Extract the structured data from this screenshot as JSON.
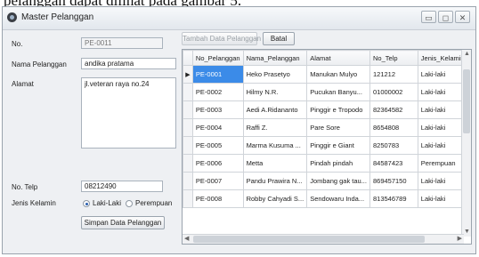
{
  "doc_text": "pelanggan dapat dilihat pada gambar 5.",
  "window": {
    "title": "Master Pelanggan",
    "min": "▭",
    "max": "◻",
    "close": "✕"
  },
  "form": {
    "no_label": "No.",
    "no_value": "PE-0011",
    "nama_label": "Nama Pelanggan",
    "nama_value": "andika pratama",
    "alamat_label": "Alamat",
    "alamat_value": "jl.veteran raya no.24",
    "telp_label": "No. Telp",
    "telp_value": "08212490",
    "jk_label": "Jenis Kelamin",
    "radio_laki": "Laki-Laki",
    "radio_perempuan": "Perempuan",
    "save_button": "Simpan Data Pelanggan",
    "add_button": "Tambah Data Pelanggan",
    "cancel_button": "Batal"
  },
  "grid": {
    "columns": [
      "No_Pelanggan",
      "Nama_Pelanggan",
      "Alamat",
      "No_Telp",
      "Jenis_Kelamin"
    ],
    "rows": [
      [
        "PE-0001",
        "Heko Prasetyo",
        "Manukan Mulyo",
        "121212",
        "Laki-laki"
      ],
      [
        "PE-0002",
        "Hilmy N.R.",
        "Pucukan Banyu...",
        "01000002",
        "Laki-laki"
      ],
      [
        "PE-0003",
        "Aedi A.Ridananto",
        "Pinggir e Tropodo",
        "82364582",
        "Laki-laki"
      ],
      [
        "PE-0004",
        "Raffi Z.",
        "Pare Sore",
        "8654808",
        "Laki-laki"
      ],
      [
        "PE-0005",
        "Marma Kusuma ...",
        "Pinggir e Giant",
        "8250783",
        "Laki-laki"
      ],
      [
        "PE-0006",
        "Metta",
        "Pindah pindah",
        "84587423",
        "Perempuan"
      ],
      [
        "PE-0007",
        "Pandu Prawira N...",
        "Jombang gak tau...",
        "869457150",
        "Laki-laki"
      ],
      [
        "PE-0008",
        "Robby Cahyadi S...",
        "Sendowaru Inda...",
        "813546789",
        "Laki-laki"
      ]
    ],
    "selected_row": 0,
    "row_marker": "▶"
  }
}
